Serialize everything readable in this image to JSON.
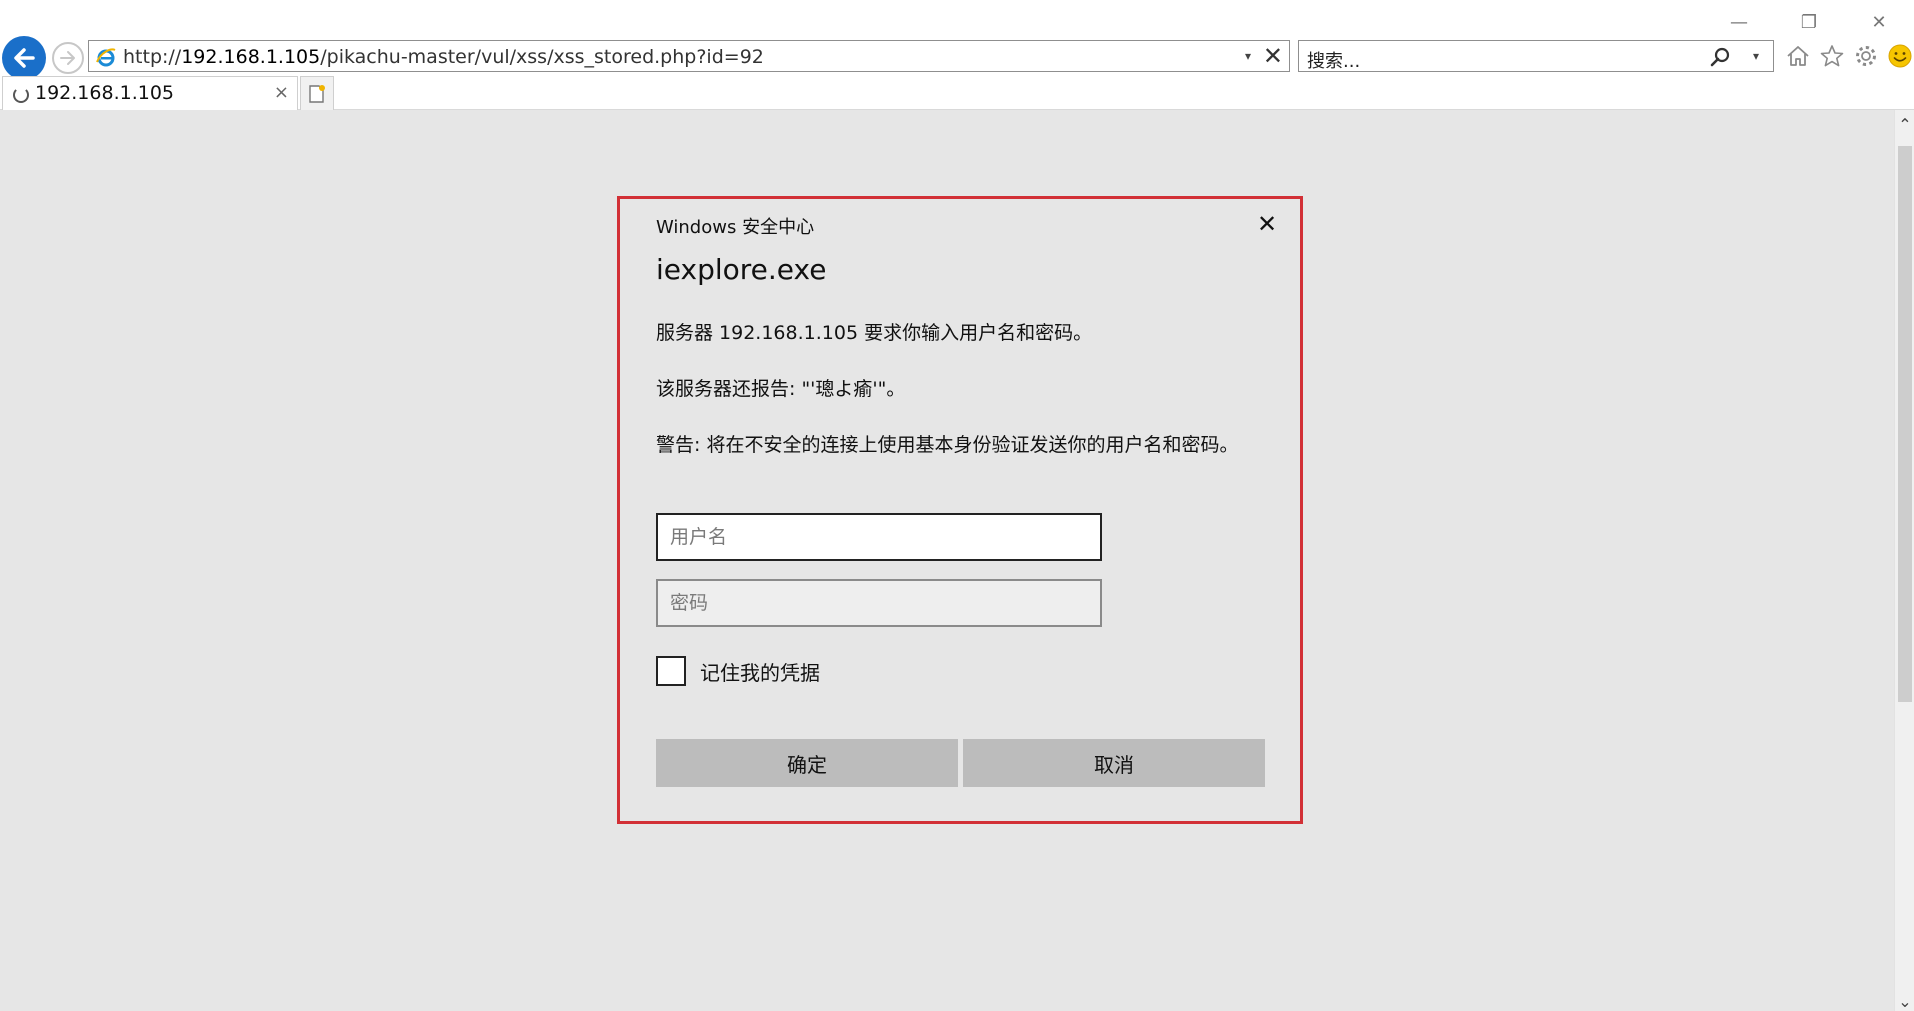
{
  "window": {
    "minimize": "—",
    "restore": "❐",
    "close": "✕"
  },
  "address_bar": {
    "scheme": "http://",
    "host": "192.168.1.105",
    "path": "/pikachu-master/vul/xss/xss_stored.php?id=92",
    "dropdown": "▾",
    "stop": "✕"
  },
  "search": {
    "placeholder": "搜索...",
    "dropdown": "▾"
  },
  "tab": {
    "title": "192.168.1.105",
    "close": "×"
  },
  "scrollbar": {
    "up": "⌃",
    "down": "⌄"
  },
  "dialog": {
    "caption": "Windows 安全中心",
    "close": "✕",
    "title": "iexplore.exe",
    "message_server": "服务器 192.168.1.105 要求你输入用户名和密码。",
    "message_report": "该服务器还报告: \"'璁よ瘉'\"。",
    "message_warning": "警告: 将在不安全的连接上使用基本身份验证发送你的用户名和密码。",
    "username_placeholder": "用户名",
    "password_placeholder": "密码",
    "remember_label": "记住我的凭据",
    "ok_label": "确定",
    "cancel_label": "取消"
  },
  "colors": {
    "dialog_border": "#d23036",
    "back_button": "#1a6fc9",
    "page_background": "#e6e6e6",
    "button_background": "#bcbcbc"
  },
  "icons": {
    "back": "back-arrow-icon",
    "forward": "forward-arrow-icon",
    "browser": "internet-explorer-icon",
    "search": "search-icon",
    "home": "home-icon",
    "favorites": "star-icon",
    "tools": "gear-icon",
    "feedback": "smiley-icon",
    "loading": "loading-spinner-icon",
    "new_tab": "new-tab-icon"
  }
}
